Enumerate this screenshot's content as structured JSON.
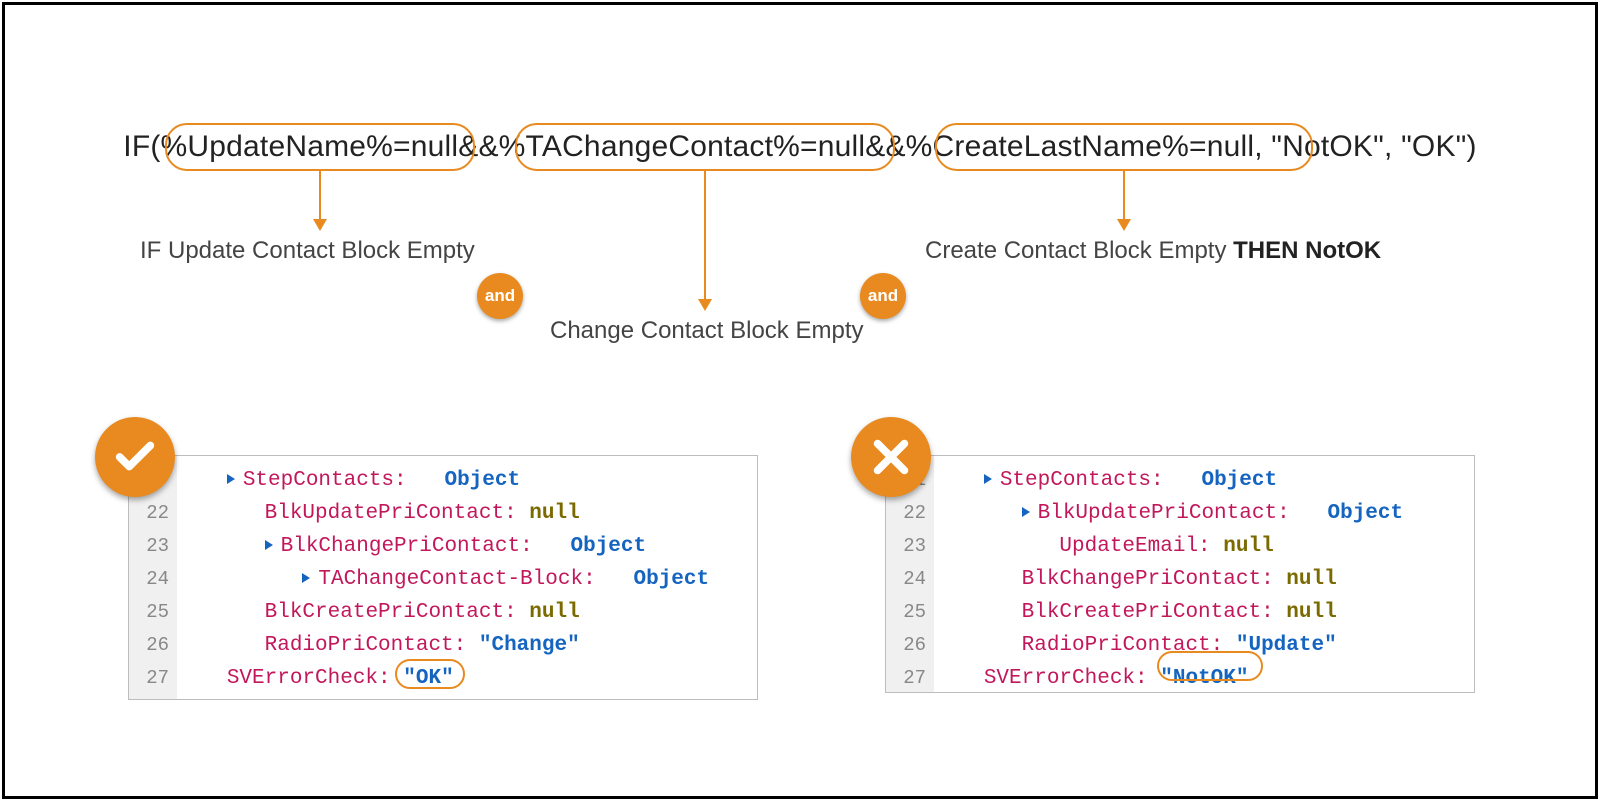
{
  "formula": {
    "text": "IF(%UpdateName%=null&&%TAChangeContact%=null&&%CreateLastName%=null, \"NotOK\", \"OK\")"
  },
  "explanation": {
    "part1": "IF  Update Contact Block Empty",
    "part2": "Change Contact Block Empty",
    "part3_prefix": "Create Contact Block Empty ",
    "part3_bold": "THEN NotOK",
    "and": "and"
  },
  "panel_ok": {
    "line_numbers": [
      "",
      "22",
      "23",
      "24",
      "25",
      "26",
      "27"
    ],
    "lines": [
      {
        "indent": 1,
        "tri": true,
        "key": "StepContacts",
        "val_type": "obj",
        "val": "Object"
      },
      {
        "indent": 2,
        "tri": false,
        "key": "BlkUpdatePriContact",
        "val_type": "null",
        "val": "null"
      },
      {
        "indent": 2,
        "tri": true,
        "key": "BlkChangePriContact",
        "val_type": "obj",
        "val": "Object"
      },
      {
        "indent": 3,
        "tri": true,
        "key": "TAChangeContact-Block",
        "val_type": "obj",
        "val": "Object"
      },
      {
        "indent": 2,
        "tri": false,
        "key": "BlkCreatePriContact",
        "val_type": "null",
        "val": "null"
      },
      {
        "indent": 2,
        "tri": false,
        "key": "RadioPriContact",
        "val_type": "str",
        "val": "\"Change\""
      },
      {
        "indent": 1,
        "tri": false,
        "key": "SVErrorCheck",
        "val_type": "str",
        "val": "\"OK\""
      }
    ]
  },
  "panel_notok": {
    "line_numbers": [
      "1",
      "22",
      "23",
      "24",
      "25",
      "26",
      "27"
    ],
    "lines": [
      {
        "indent": 1,
        "tri": true,
        "key": "StepContacts",
        "val_type": "obj",
        "val": "Object"
      },
      {
        "indent": 2,
        "tri": true,
        "key": "BlkUpdatePriContact",
        "val_type": "obj",
        "val": "Object"
      },
      {
        "indent": 3,
        "tri": false,
        "key": "UpdateEmail",
        "val_type": "null",
        "val": "null"
      },
      {
        "indent": 2,
        "tri": false,
        "key": "BlkChangePriContact",
        "val_type": "null",
        "val": "null"
      },
      {
        "indent": 2,
        "tri": false,
        "key": "BlkCreatePriContact",
        "val_type": "null",
        "val": "null"
      },
      {
        "indent": 2,
        "tri": false,
        "key": "RadioPriContact",
        "val_type": "str",
        "val": "\"Update\""
      },
      {
        "indent": 1,
        "tri": false,
        "key": "SVErrorCheck",
        "val_type": "str",
        "val": "\"NotOK\""
      }
    ]
  }
}
